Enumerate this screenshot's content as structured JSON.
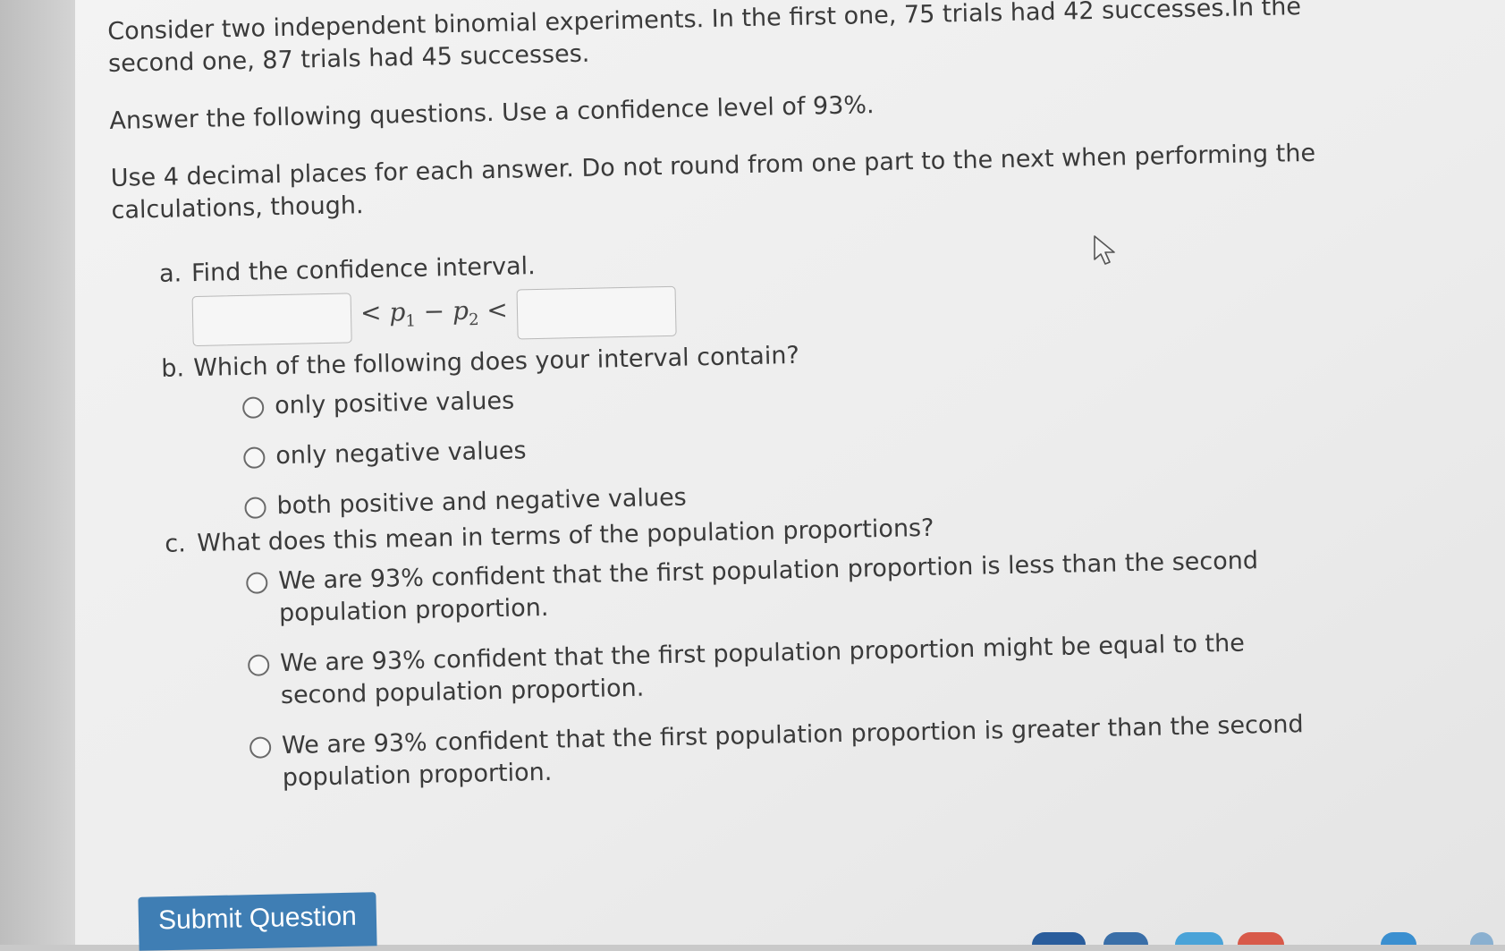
{
  "question": {
    "intro": "Consider two independent binomial experiments. In the first one, 75 trials had 42 successes.In the second one, 87 trials had 45 successes.",
    "instruction": "Answer the following questions. Use a confidence level of 93%.",
    "rounding_note": "Use 4 decimal places for each answer. Do not round from one part to the next when performing the calculations, though."
  },
  "part_a": {
    "label": "a.",
    "prompt": "Find the confidence interval.",
    "lower_value": "",
    "upper_value": "",
    "lt_left": "<",
    "p1": "p",
    "sub1": "1",
    "minus": "−",
    "p2": "p",
    "sub2": "2",
    "lt_right": "<"
  },
  "part_b": {
    "label": "b.",
    "prompt": "Which of the following does your interval contain?",
    "options": [
      "only positive values",
      "only negative values",
      "both positive and negative values"
    ]
  },
  "part_c": {
    "label": "c.",
    "prompt": "What does this mean in terms of the population proportions?",
    "options": [
      "We are 93% confident that the first population proportion is less than the second population proportion.",
      "We are 93% confident that the first population proportion might be equal to the second population proportion.",
      "We are 93% confident that the first population proportion is greater than the second population proportion."
    ]
  },
  "submit_label": "Submit Question",
  "colors": {
    "submit_bg": "#3f7eb4",
    "text": "#3a3a3a"
  }
}
